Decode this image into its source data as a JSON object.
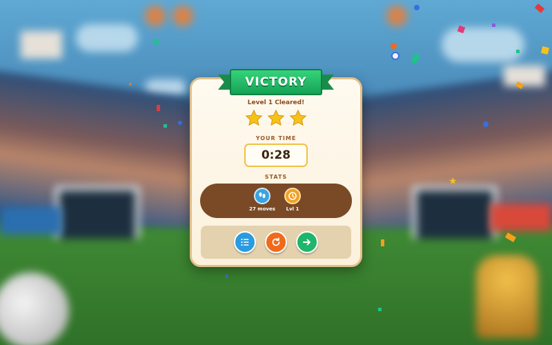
{
  "dialog": {
    "title": "VICTORY",
    "subtitle": "Level 1 Cleared!",
    "stars_earned": 3,
    "stars_total": 3,
    "time_label": "YOUR TIME",
    "time_value": "0:28",
    "stats_label": "STATS",
    "stats": [
      {
        "icon": "footsteps-icon",
        "text": "27 moves",
        "color": "#3aa3e0"
      },
      {
        "icon": "clock-icon",
        "text": "Lvl 1",
        "color": "#f2a024"
      }
    ],
    "actions": [
      {
        "name": "menu-button",
        "icon": "list-icon",
        "color": "#2a9be0"
      },
      {
        "name": "restart-button",
        "icon": "restart-icon",
        "color": "#f06a1a"
      },
      {
        "name": "next-button",
        "icon": "arrow-right-icon",
        "color": "#1fb56a"
      }
    ]
  },
  "colors": {
    "banner_green": "#15a356",
    "star_gold": "#f5c21b",
    "stats_panel": "#7a4a26",
    "actions_panel": "#e4d2ae"
  }
}
